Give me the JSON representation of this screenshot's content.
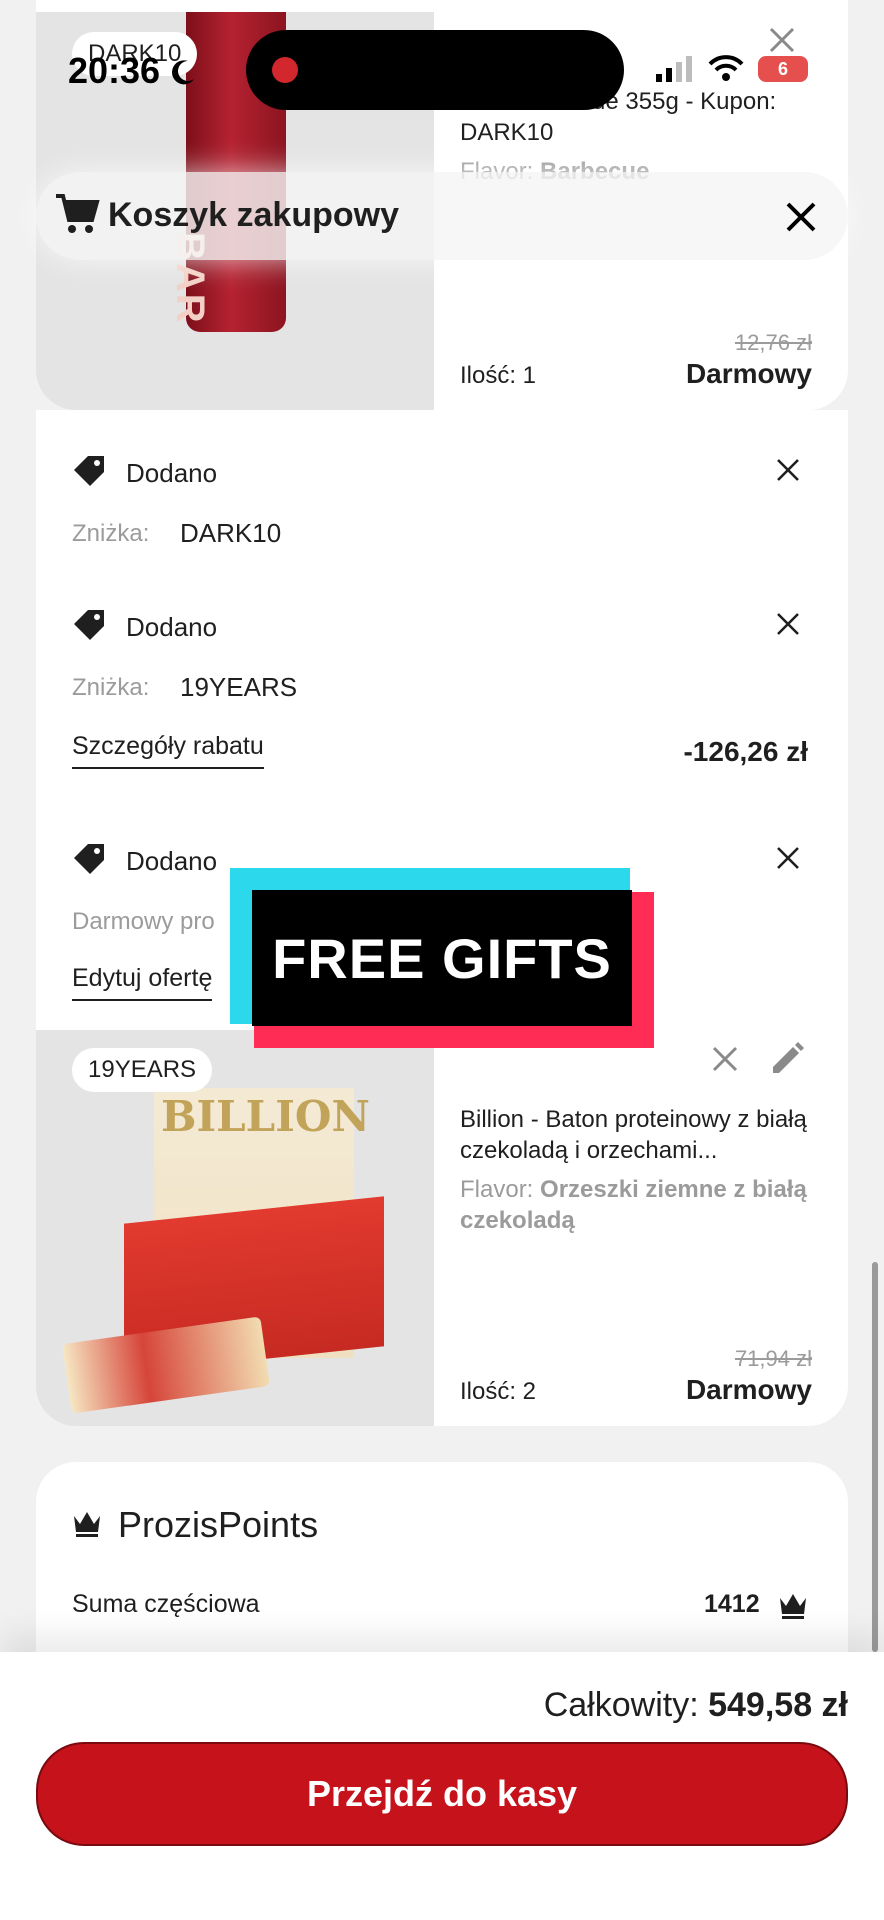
{
  "status_bar": {
    "time": "20:36",
    "battery": "6"
  },
  "header": {
    "title": "Koszyk zakupowy"
  },
  "product1": {
    "badge": "DARK10",
    "title_visible": "Zero Barbecue 355g - Kupon: DARK10",
    "flavor_label": "Flavor:",
    "flavor_value": "Barbecue",
    "qty": "Ilość: 1",
    "old_price": "12,76 zł",
    "price": "Darmowy"
  },
  "coupons": [
    {
      "status": "Dodano",
      "label": "Zniżka:",
      "code": "DARK10"
    },
    {
      "status": "Dodano",
      "label": "Zniżka:",
      "code": "19YEARS",
      "details_link": "Szczegóły rabatu",
      "amount": "-126,26 zł"
    },
    {
      "status": "Dodano",
      "label": "Darmowy pro",
      "edit_link": "Edytuj ofertę"
    }
  ],
  "overlay": {
    "text": "FREE GIFTS"
  },
  "product2": {
    "badge": "19YEARS",
    "title": "Billion - Baton proteinowy z białą czekoladą i orzechami...",
    "flavor_label": "Flavor:",
    "flavor_value": "Orzeszki ziemne z białą czekoladą",
    "qty": "Ilość: 2",
    "old_price": "71,94 zł",
    "price": "Darmowy",
    "art_text": "BILLION"
  },
  "points": {
    "title": "ProzisPoints",
    "subtotal_label": "Suma częściowa",
    "subtotal_value": "1412"
  },
  "footer": {
    "total_label": "Całkowity:",
    "total_value": "549,58 zł",
    "checkout_label": "Przejdź do kasy"
  },
  "colors": {
    "accent_red": "#c5121b",
    "overlay_cyan": "#2bd8ec",
    "overlay_pink": "#ff2d55"
  }
}
